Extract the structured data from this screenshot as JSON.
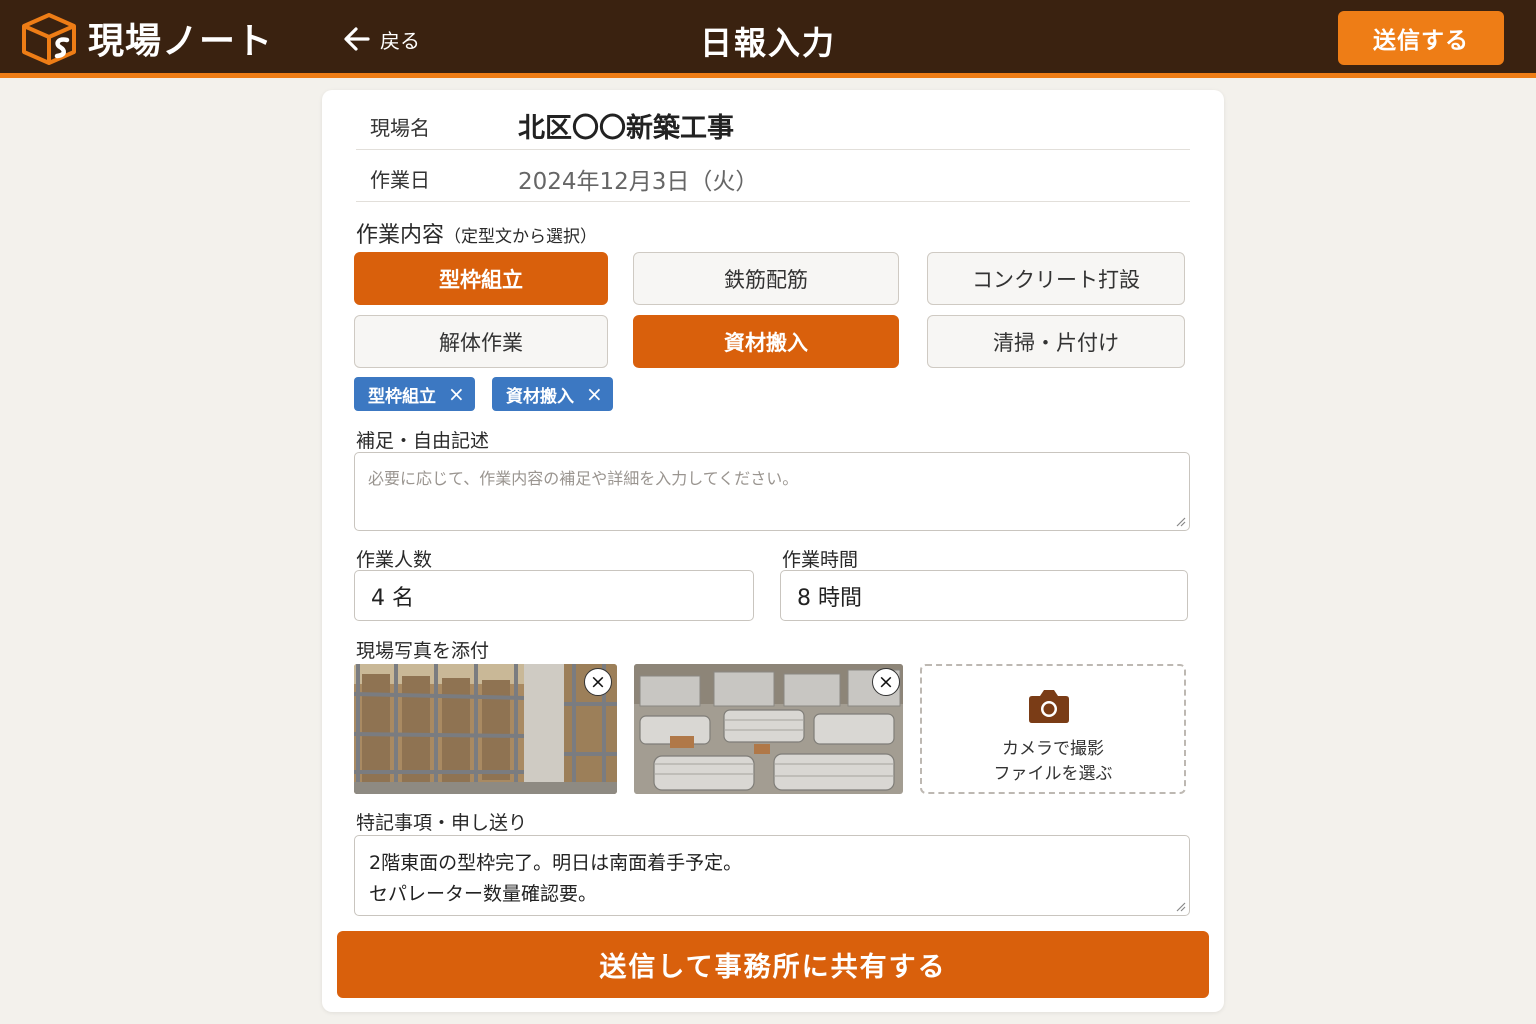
{
  "header": {
    "app_name": "現場ノート",
    "back_label": "戻る",
    "title": "日報入力",
    "send_label": "送信する"
  },
  "site": {
    "label": "現場名",
    "value": "北区〇〇新築工事"
  },
  "date": {
    "label": "作業日",
    "value": "2024年12月3日（火）"
  },
  "work": {
    "label": "作業内容",
    "hint": "（定型文から選択）",
    "options": [
      {
        "label": "型枠組立",
        "selected": true
      },
      {
        "label": "鉄筋配筋",
        "selected": false
      },
      {
        "label": "コンクリート打設",
        "selected": false
      },
      {
        "label": "解体作業",
        "selected": false
      },
      {
        "label": "資材搬入",
        "selected": true
      },
      {
        "label": "清掃・片付け",
        "selected": false
      }
    ],
    "tags": [
      {
        "label": "型枠組立",
        "remove": "×"
      },
      {
        "label": "資材搬入",
        "remove": "×"
      }
    ]
  },
  "supplement": {
    "label": "補足・自由記述",
    "placeholder": "必要に応じて、作業内容の補足や詳細を入力してください。"
  },
  "workers": {
    "label": "作業人数",
    "value": "4 名"
  },
  "hours": {
    "label": "作業時間",
    "value": "8 時間"
  },
  "photos": {
    "label": "現場写真を添付",
    "remove": "×",
    "camera_label": "カメラで撮影",
    "file_label": "ファイルを選ぶ"
  },
  "notes": {
    "label": "特記事項・申し送り",
    "line1": "2階東面の型枠完了。明日は南面着手予定。",
    "line2": "セパレーター数量確認要。"
  },
  "submit_label": "送信して事務所に共有する",
  "colors": {
    "header_bg": "#3a2210",
    "accent": "#ee7d16",
    "selected": "#d9600c",
    "tag": "#3c78c2"
  }
}
